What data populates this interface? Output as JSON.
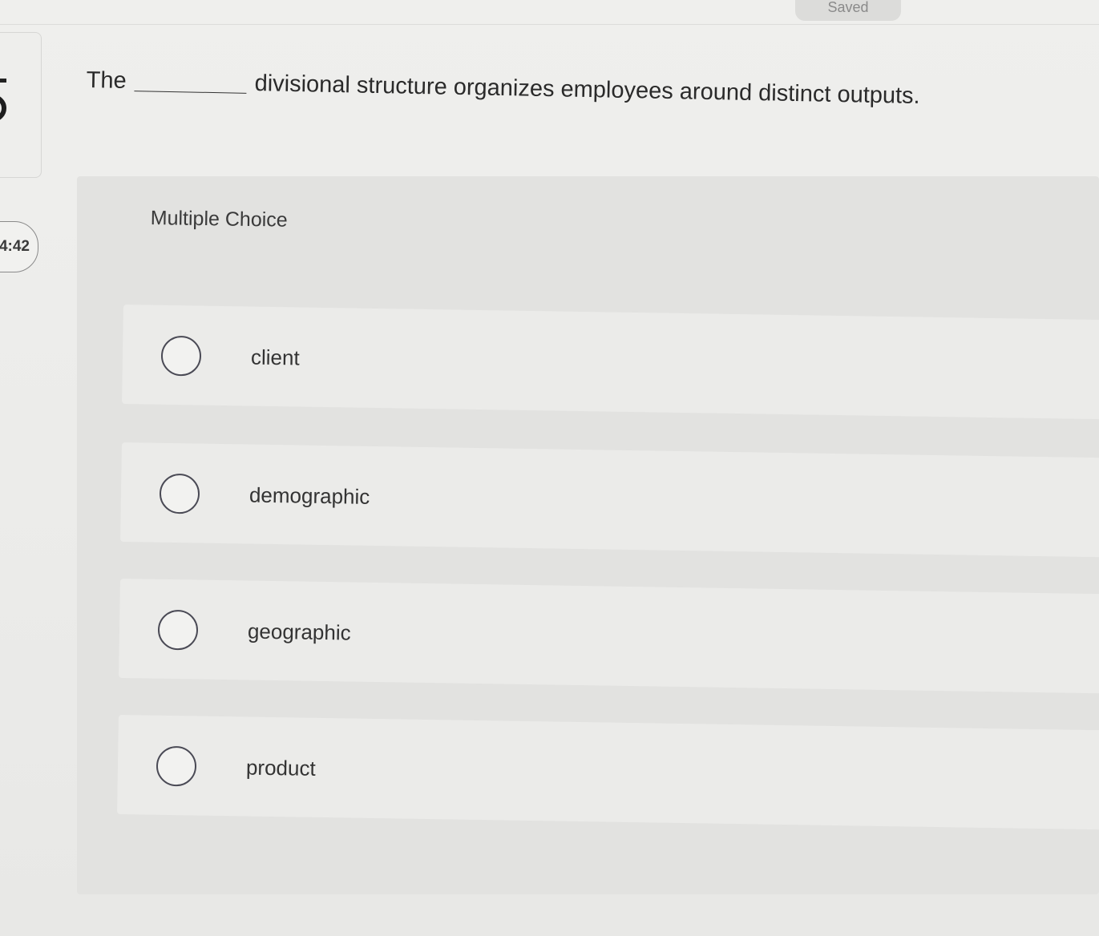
{
  "header": {
    "saved_label": "Saved"
  },
  "sidebar": {
    "timer": "4:42"
  },
  "question": {
    "text_before": "The",
    "text_after": "divisional structure organizes employees around distinct outputs."
  },
  "choices": {
    "type_label": "Multiple Choice",
    "options": [
      {
        "label": "client"
      },
      {
        "label": "demographic"
      },
      {
        "label": "geographic"
      },
      {
        "label": "product"
      }
    ]
  }
}
